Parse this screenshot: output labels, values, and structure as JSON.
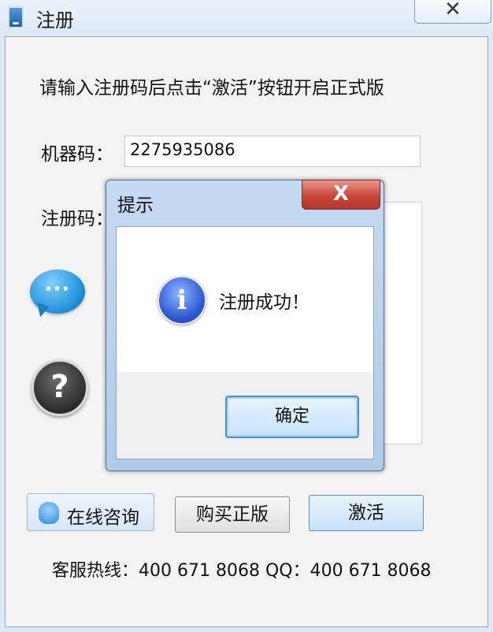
{
  "window": {
    "title": "注册",
    "close_glyph": "✕",
    "icon": "phone-app-icon"
  },
  "main": {
    "instruction": "请输入注册码后点击“激活”按钮开启正式版",
    "machine_code_label": "机器码：",
    "machine_code_value": "2275935086",
    "reg_code_label": "注册码：",
    "reg_code_value": ""
  },
  "side_icons": {
    "chat": "chat-bubble-icon",
    "help": "help-question-icon",
    "chat_glyph": "···",
    "help_glyph": "?"
  },
  "buttons": {
    "consult": "在线咨询",
    "buy": "购买正版",
    "activate": "激活"
  },
  "footer": {
    "hotline": "客服热线：400 671 8068 QQ：400 671 8068"
  },
  "dialog": {
    "title": "提示",
    "close_glyph": "X",
    "message": "注册成功！",
    "info_glyph": "i",
    "ok_label": "确定"
  },
  "colors": {
    "accent": "#4a8fd0",
    "close_red": "#c9473a",
    "window_bg": "#f3f3f3"
  }
}
